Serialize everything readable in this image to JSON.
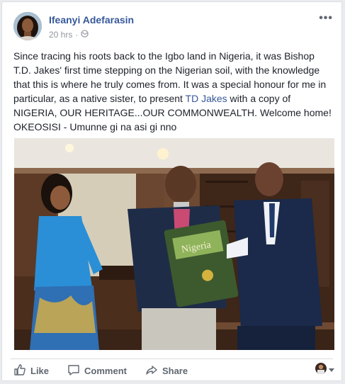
{
  "post": {
    "author": "Ifeanyi Adefarasin",
    "time": "20 hrs",
    "separator": "·",
    "more_glyph": "•••",
    "text_before_link": "Since tracing his roots back to the Igbo land in Nigeria, it was Bishop T.D. Jakes' first time stepping on the Nigerian soil, with the knowledge that this is where he truly comes from. It was a special honour for me in particular, as a native sister, to present ",
    "link_text": "TD Jakes",
    "text_after_link": " with a copy of NIGERIA, OUR HERITAGE...OUR COMMONWEALTH. Welcome home! OKEOSISI - Umunne gi na asi gi nno",
    "book_cover_title": "Nigeria"
  },
  "actions": {
    "like": "Like",
    "comment": "Comment",
    "share": "Share"
  },
  "icons": {
    "privacy": "globe-icon",
    "like": "thumbs-up-icon",
    "comment": "comment-bubble-icon",
    "share": "share-arrow-icon",
    "more": "ellipsis-icon",
    "audience": "reaction-avatar-icon"
  },
  "colors": {
    "link": "#365899",
    "text": "#1d2129",
    "meta": "#90949c",
    "action": "#606770"
  }
}
